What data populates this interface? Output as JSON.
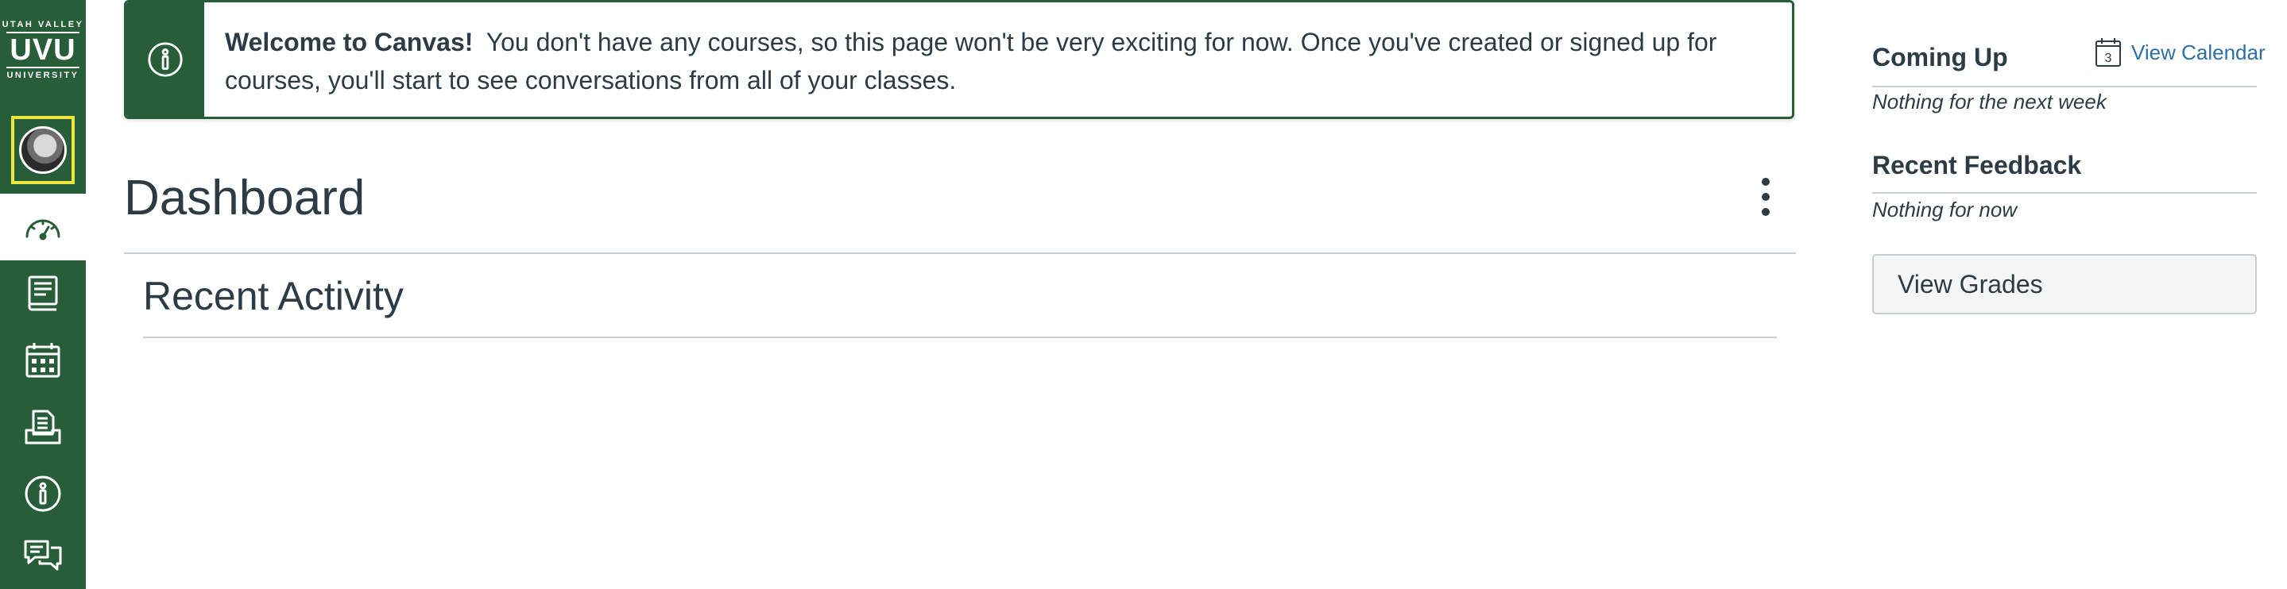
{
  "nav": {
    "logo": {
      "top": "UTAH VALLEY",
      "main": "UVU",
      "bottom": "UNIVERSITY"
    },
    "items": [
      {
        "id": "account",
        "icon": "user-avatar"
      },
      {
        "id": "dashboard",
        "icon": "speedometer-icon",
        "active": true
      },
      {
        "id": "courses",
        "icon": "book-icon"
      },
      {
        "id": "calendar",
        "icon": "calendar-icon"
      },
      {
        "id": "inbox",
        "icon": "inbox-icon"
      },
      {
        "id": "help",
        "icon": "info-icon"
      },
      {
        "id": "commons",
        "icon": "chat-bubbles-icon"
      }
    ]
  },
  "alert": {
    "icon": "info-icon",
    "title": "Welcome to Canvas!",
    "message": "You don't have any courses, so this page won't be very exciting for now. Once you've created or signed up for courses, you'll start to see conversations from all of your classes."
  },
  "dashboard": {
    "title": "Dashboard",
    "options_icon": "kebab-menu-icon",
    "recent_activity": "Recent Activity"
  },
  "sidebar": {
    "coming_up": {
      "heading": "Coming Up",
      "calendar_day": "3",
      "view_calendar": "View Calendar",
      "empty": "Nothing for the next week"
    },
    "recent_feedback": {
      "heading": "Recent Feedback",
      "empty": "Nothing for now"
    },
    "view_grades": "View Grades"
  },
  "colors": {
    "nav_bg": "#275d38",
    "focus_ring": "#ece63d",
    "text": "#2d3b45",
    "link": "#2d6fa7",
    "rule": "#c7cdd1"
  }
}
